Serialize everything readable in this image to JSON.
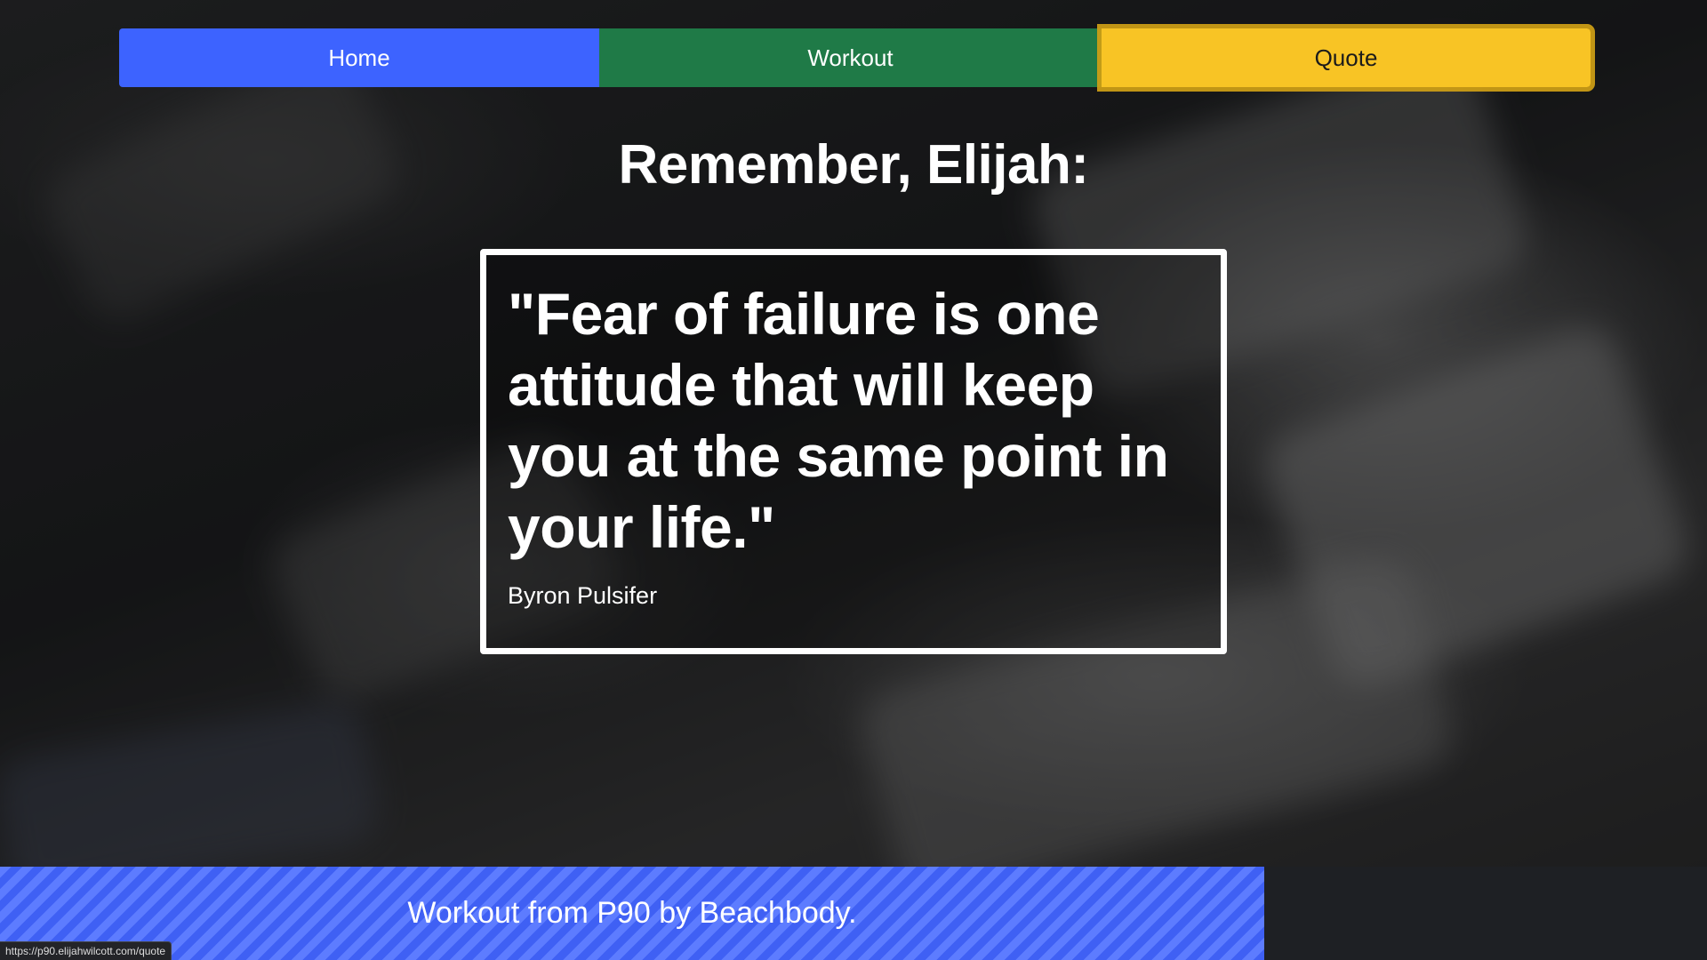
{
  "nav": {
    "home_label": "Home",
    "workout_label": "Workout",
    "quote_label": "Quote",
    "active": "Quote"
  },
  "main": {
    "heading": "Remember, Elijah:",
    "quote": "\"Fear of failure is one attitude that will keep you at the same point in your life.\"",
    "author": "Byron Pulsifer"
  },
  "footer": {
    "text": "Workout from P90 by Beachbody."
  },
  "status_bar": {
    "url": "https://p90.elijahwilcott.com/quote"
  },
  "colors": {
    "home": "#3d63ff",
    "workout": "#1f7a47",
    "quote": "#f8c425",
    "footer_strip": "#4a6cff"
  }
}
